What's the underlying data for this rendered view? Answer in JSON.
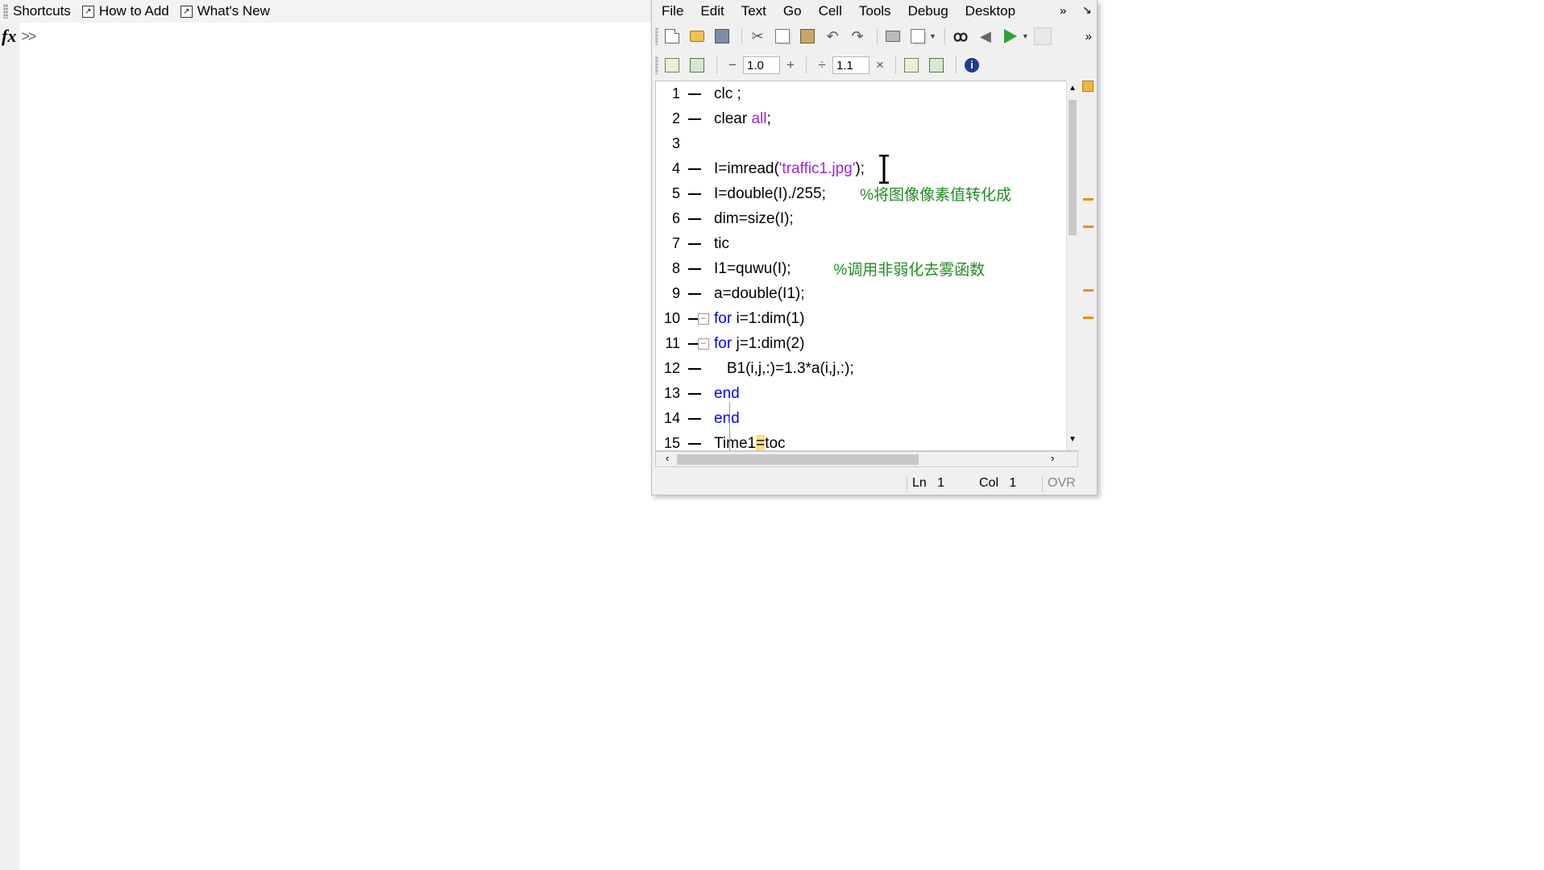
{
  "shortcuts_bar": {
    "items": [
      {
        "label": "Shortcuts"
      },
      {
        "label": "How to Add"
      },
      {
        "label": "What's New"
      }
    ]
  },
  "command_window": {
    "fx": "fx",
    "prompt": ">>"
  },
  "editor": {
    "menu": [
      "File",
      "Edit",
      "Text",
      "Go",
      "Cell",
      "Tools",
      "Debug",
      "Desktop"
    ],
    "menu_more": "»",
    "cell_toolbar": {
      "decrement": "−",
      "increment_value": "1.0",
      "plus": "+",
      "divide": "÷",
      "divide_value": "1.1",
      "times": "×"
    },
    "code_lines": [
      {
        "n": "1",
        "parts": [
          {
            "t": "clc ;",
            "c": "txt"
          }
        ]
      },
      {
        "n": "2",
        "parts": [
          {
            "t": "clear ",
            "c": "txt"
          },
          {
            "t": "all",
            "c": "str"
          },
          {
            "t": ";",
            "c": "txt"
          }
        ]
      },
      {
        "n": "3",
        "parts": []
      },
      {
        "n": "4",
        "parts": [
          {
            "t": "I=imread(",
            "c": "txt"
          },
          {
            "t": "'traffic1.jpg'",
            "c": "str"
          },
          {
            "t": ");",
            "c": "txt"
          }
        ]
      },
      {
        "n": "5",
        "parts": [
          {
            "t": "I=double(I)./255;        ",
            "c": "txt"
          },
          {
            "t": "%将图像像素值转化成",
            "c": "cmt"
          }
        ]
      },
      {
        "n": "6",
        "parts": [
          {
            "t": "dim=size(I);",
            "c": "txt"
          }
        ]
      },
      {
        "n": "7",
        "parts": [
          {
            "t": "tic",
            "c": "txt"
          }
        ]
      },
      {
        "n": "8",
        "parts": [
          {
            "t": "I1=quwu(I);          ",
            "c": "txt"
          },
          {
            "t": "%调用非弱化去雾函数",
            "c": "cmt"
          }
        ]
      },
      {
        "n": "9",
        "parts": [
          {
            "t": "a=double(I1);",
            "c": "txt"
          }
        ]
      },
      {
        "n": "10",
        "parts": [
          {
            "t": "for ",
            "c": "kw"
          },
          {
            "t": "i=1:dim(1)",
            "c": "txt"
          }
        ]
      },
      {
        "n": "11",
        "parts": [
          {
            "t": "for ",
            "c": "kw"
          },
          {
            "t": "j=1:dim(2)",
            "c": "txt"
          }
        ]
      },
      {
        "n": "12",
        "parts": [
          {
            "t": "   B1(i,j,:)=1.3*a(i,j,:);",
            "c": "txt"
          }
        ]
      },
      {
        "n": "13",
        "parts": [
          {
            "t": "end",
            "c": "kw"
          }
        ]
      },
      {
        "n": "14",
        "parts": [
          {
            "t": "end",
            "c": "kw"
          }
        ]
      },
      {
        "n": "15",
        "parts": [
          {
            "t": "Time1",
            "c": "txt"
          },
          {
            "t": "=",
            "c": "hl"
          },
          {
            "t": "toc",
            "c": "txt"
          }
        ]
      }
    ],
    "status": {
      "ln_label": "Ln",
      "ln_value": "1",
      "col_label": "Col",
      "col_value": "1",
      "ovr": "OVR"
    },
    "colors": {
      "keyword": "#0000ff",
      "string": "#a020f0",
      "comment": "#228b22",
      "warning_marker": "#f08c00"
    }
  }
}
